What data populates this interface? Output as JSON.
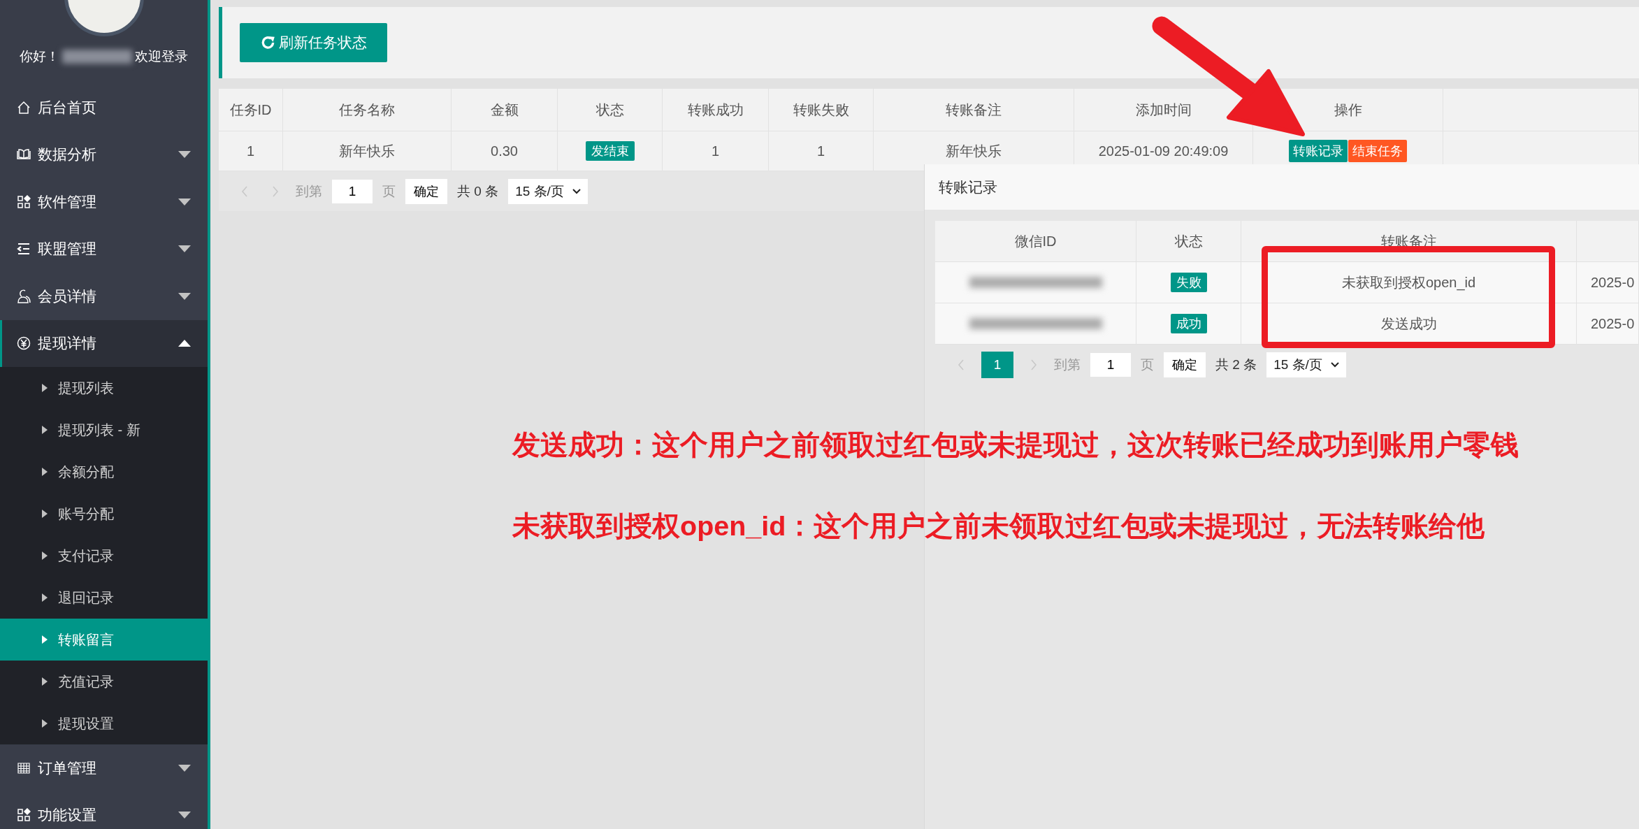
{
  "sidebar": {
    "greeting": "你好！",
    "welcome": "欢迎登录",
    "items": [
      {
        "label": "后台首页",
        "kind": "link"
      },
      {
        "label": "数据分析",
        "kind": "group",
        "expanded": false
      },
      {
        "label": "软件管理",
        "kind": "group",
        "expanded": false
      },
      {
        "label": "联盟管理",
        "kind": "group",
        "expanded": false
      },
      {
        "label": "会员详情",
        "kind": "group",
        "expanded": false
      },
      {
        "label": "提现详情",
        "kind": "group",
        "expanded": true,
        "children": [
          {
            "label": "提现列表",
            "selected": false
          },
          {
            "label": "提现列表 - 新",
            "selected": false
          },
          {
            "label": "余额分配",
            "selected": false
          },
          {
            "label": "账号分配",
            "selected": false
          },
          {
            "label": "支付记录",
            "selected": false
          },
          {
            "label": "退回记录",
            "selected": false
          },
          {
            "label": "转账留言",
            "selected": true
          },
          {
            "label": "充值记录",
            "selected": false
          },
          {
            "label": "提现设置",
            "selected": false
          }
        ]
      },
      {
        "label": "订单管理",
        "kind": "group",
        "expanded": false
      },
      {
        "label": "功能设置",
        "kind": "group",
        "expanded": false
      }
    ]
  },
  "toolbar": {
    "refresh_button": "刷新任务状态"
  },
  "table": {
    "columns": [
      "任务ID",
      "任务名称",
      "金额",
      "状态",
      "转账成功",
      "转账失败",
      "转账备注",
      "添加时间",
      "操作"
    ],
    "rows": [
      {
        "id": "1",
        "name": "新年快乐",
        "amount": "0.30",
        "status": "发结束",
        "success": "1",
        "fail": "1",
        "note": "新年快乐",
        "time": "2025-01-09 20:49:09",
        "actions": [
          {
            "label": "转账记录",
            "kind": "primary"
          },
          {
            "label": "结束任务",
            "kind": "danger"
          }
        ]
      }
    ],
    "pager": {
      "goto": "到第",
      "page_input": "1",
      "page_unit": "页",
      "confirm": "确定",
      "total": "共 0 条",
      "page_size": "15 条/页"
    }
  },
  "dialog": {
    "title": "转账记录",
    "columns": [
      "微信ID",
      "状态",
      "转账备注"
    ],
    "rows": [
      {
        "status": "失败",
        "note": "未获取到授权open_id",
        "column_4": "2025-0"
      },
      {
        "status": "成功",
        "note": "发送成功",
        "column_4": "2025-0"
      }
    ],
    "pager": {
      "pages": [
        {
          "label": "1",
          "selected": true
        }
      ],
      "goto": "到第",
      "page_input": "1",
      "page_unit": "页",
      "confirm": "确定",
      "total": "共 2 条",
      "page_size": "15 条/页"
    }
  },
  "annotations": [
    "发送成功：这个用户之前领取过红包或未提现过，这次转账已经成功到账用户零钱",
    "未获取到授权open_id：这个用户之前未领取过红包或未提现过，无法转账给他"
  ]
}
